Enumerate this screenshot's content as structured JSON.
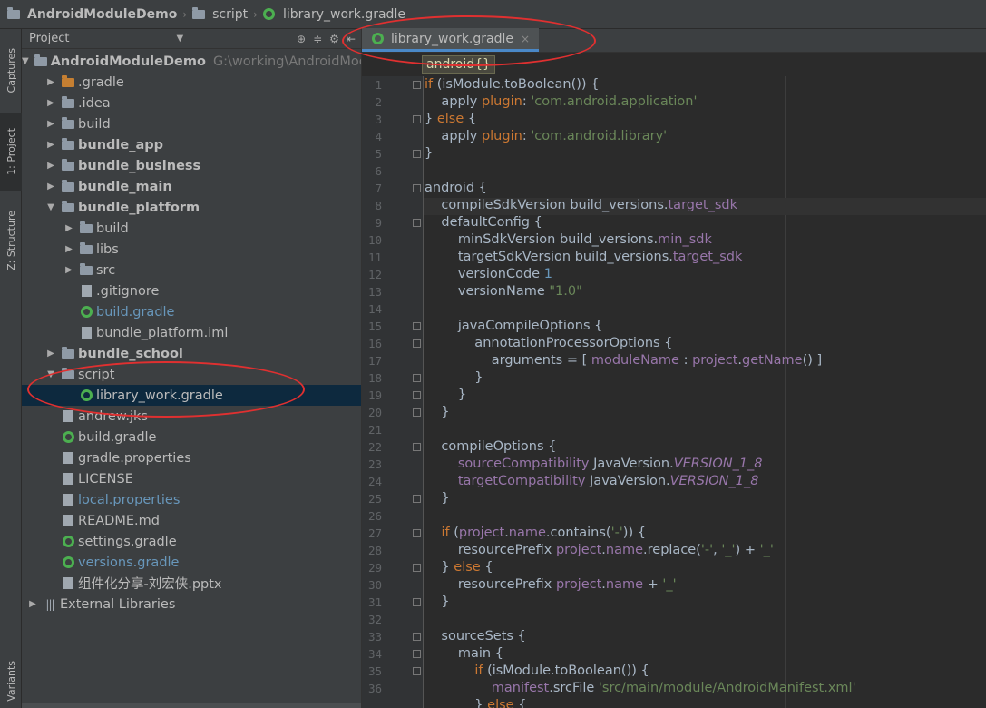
{
  "breadcrumb": {
    "project": "AndroidModuleDemo",
    "folder": "script",
    "file": "library_work.gradle"
  },
  "left_strip": {
    "tabs": [
      "Captures",
      "1: Project",
      "Z: Structure"
    ],
    "bottom_tab": "Variants"
  },
  "project_panel": {
    "header": "Project",
    "root_path": "G:\\working\\AndroidModu",
    "items": [
      {
        "label": "AndroidModuleDemo",
        "icon": "module-folder-icon"
      },
      {
        "label": ".gradle",
        "icon": "folder-icon"
      },
      {
        "label": ".idea",
        "icon": "folder-icon"
      },
      {
        "label": "build",
        "icon": "folder-icon"
      },
      {
        "label": "bundle_app",
        "icon": "module-folder-icon"
      },
      {
        "label": "bundle_business",
        "icon": "module-folder-icon"
      },
      {
        "label": "bundle_main",
        "icon": "module-folder-icon"
      },
      {
        "label": "bundle_platform",
        "icon": "module-folder-icon"
      },
      {
        "label": "build",
        "icon": "folder-icon"
      },
      {
        "label": "libs",
        "icon": "folder-icon"
      },
      {
        "label": "src",
        "icon": "folder-icon"
      },
      {
        "label": ".gitignore",
        "icon": "file-icon"
      },
      {
        "label": "build.gradle",
        "icon": "gradle-icon"
      },
      {
        "label": "bundle_platform.iml",
        "icon": "file-icon"
      },
      {
        "label": "bundle_school",
        "icon": "module-folder-icon"
      },
      {
        "label": "script",
        "icon": "folder-icon"
      },
      {
        "label": "library_work.gradle",
        "icon": "gradle-icon"
      },
      {
        "label": "andrew.jks",
        "icon": "file-icon"
      },
      {
        "label": "build.gradle",
        "icon": "gradle-icon"
      },
      {
        "label": "gradle.properties",
        "icon": "file-icon"
      },
      {
        "label": "LICENSE",
        "icon": "file-icon"
      },
      {
        "label": "local.properties",
        "icon": "file-icon"
      },
      {
        "label": "README.md",
        "icon": "file-icon"
      },
      {
        "label": "settings.gradle",
        "icon": "gradle-icon"
      },
      {
        "label": "versions.gradle",
        "icon": "gradle-icon"
      },
      {
        "label": "组件化分享-刘宏侠.pptx",
        "icon": "file-icon"
      },
      {
        "label": "External Libraries",
        "icon": "library-icon"
      }
    ]
  },
  "editor": {
    "tab": "library_work.gradle",
    "breadcrumb": "android{}",
    "line_numbers": [
      "1",
      "2",
      "3",
      "4",
      "5",
      "6",
      "7",
      "8",
      "9",
      "10",
      "11",
      "12",
      "13",
      "14",
      "15",
      "16",
      "17",
      "18",
      "19",
      "20",
      "21",
      "22",
      "23",
      "24",
      "25",
      "26",
      "27",
      "28",
      "29",
      "30",
      "31",
      "32",
      "33",
      "34",
      "35",
      "36"
    ],
    "code": [
      [
        [
          "k",
          "if "
        ],
        [
          "t",
          "(isModule."
        ],
        [
          "t",
          "toBoolean"
        ],
        [
          "t",
          "()) {"
        ]
      ],
      [
        [
          "t",
          "    apply "
        ],
        [
          "k",
          "plugin"
        ],
        [
          "t",
          ": "
        ],
        [
          "s",
          "'com.android.application'"
        ]
      ],
      [
        [
          "t",
          "} "
        ],
        [
          "k",
          "else"
        ],
        [
          "t",
          " {"
        ]
      ],
      [
        [
          "t",
          "    apply "
        ],
        [
          "k",
          "plugin"
        ],
        [
          "t",
          ": "
        ],
        [
          "s",
          "'com.android.library'"
        ]
      ],
      [
        [
          "t",
          "}"
        ]
      ],
      [
        [
          "t",
          ""
        ]
      ],
      [
        [
          "t",
          "android {"
        ]
      ],
      [
        [
          "t",
          "    compileSdkVersion build_versions."
        ],
        [
          "p",
          "target_sdk"
        ]
      ],
      [
        [
          "t",
          "    defaultConfig {"
        ]
      ],
      [
        [
          "t",
          "        minSdkVersion build_versions."
        ],
        [
          "p",
          "min_sdk"
        ]
      ],
      [
        [
          "t",
          "        targetSdkVersion build_versions."
        ],
        [
          "p",
          "target_sdk"
        ]
      ],
      [
        [
          "t",
          "        versionCode "
        ],
        [
          "n",
          "1"
        ]
      ],
      [
        [
          "t",
          "        versionName "
        ],
        [
          "s",
          "\"1.0\""
        ]
      ],
      [
        [
          "t",
          ""
        ]
      ],
      [
        [
          "t",
          "        javaCompileOptions {"
        ]
      ],
      [
        [
          "t",
          "            annotationProcessorOptions {"
        ]
      ],
      [
        [
          "t",
          "                arguments = [ "
        ],
        [
          "p",
          "moduleName"
        ],
        [
          "t",
          " : "
        ],
        [
          "p",
          "project"
        ],
        [
          "t",
          "."
        ],
        [
          "p",
          "getName"
        ],
        [
          "t",
          "() ]"
        ]
      ],
      [
        [
          "t",
          "            }"
        ]
      ],
      [
        [
          "t",
          "        }"
        ]
      ],
      [
        [
          "t",
          "    }"
        ]
      ],
      [
        [
          "t",
          ""
        ]
      ],
      [
        [
          "t",
          "    compileOptions {"
        ]
      ],
      [
        [
          "t",
          "        "
        ],
        [
          "p",
          "sourceCompatibility"
        ],
        [
          "t",
          " JavaVersion."
        ],
        [
          "pi",
          "VERSION_1_8"
        ]
      ],
      [
        [
          "t",
          "        "
        ],
        [
          "p",
          "targetCompatibility"
        ],
        [
          "t",
          " JavaVersion."
        ],
        [
          "pi",
          "VERSION_1_8"
        ]
      ],
      [
        [
          "t",
          "    }"
        ]
      ],
      [
        [
          "t",
          ""
        ]
      ],
      [
        [
          "t",
          "    "
        ],
        [
          "k",
          "if "
        ],
        [
          "t",
          "("
        ],
        [
          "p",
          "project"
        ],
        [
          "t",
          "."
        ],
        [
          "p",
          "name"
        ],
        [
          "t",
          ".contains("
        ],
        [
          "s",
          "'-'"
        ],
        [
          "t",
          ")) {"
        ]
      ],
      [
        [
          "t",
          "        resourcePrefix "
        ],
        [
          "p",
          "project"
        ],
        [
          "t",
          "."
        ],
        [
          "p",
          "name"
        ],
        [
          "t",
          ".replace("
        ],
        [
          "s",
          "'-'"
        ],
        [
          "t",
          ", "
        ],
        [
          "s",
          "'_'"
        ],
        [
          "t",
          ") + "
        ],
        [
          "s",
          "'_'"
        ]
      ],
      [
        [
          "t",
          "    } "
        ],
        [
          "k",
          "else"
        ],
        [
          "t",
          " {"
        ]
      ],
      [
        [
          "t",
          "        resourcePrefix "
        ],
        [
          "p",
          "project"
        ],
        [
          "t",
          "."
        ],
        [
          "p",
          "name"
        ],
        [
          "t",
          " + "
        ],
        [
          "s",
          "'_'"
        ]
      ],
      [
        [
          "t",
          "    }"
        ]
      ],
      [
        [
          "t",
          ""
        ]
      ],
      [
        [
          "t",
          "    sourceSets {"
        ]
      ],
      [
        [
          "t",
          "        main {"
        ]
      ],
      [
        [
          "t",
          "            "
        ],
        [
          "k",
          "if "
        ],
        [
          "t",
          "(isModule."
        ],
        [
          "t",
          "toBoolean"
        ],
        [
          "t",
          "()) {"
        ]
      ],
      [
        [
          "t",
          "                "
        ],
        [
          "p",
          "manifest"
        ],
        [
          "t",
          ".srcFile "
        ],
        [
          "s",
          "'src/main/module/AndroidManifest.xml'"
        ]
      ],
      [
        [
          "t",
          "            } "
        ],
        [
          "k",
          "else"
        ],
        [
          "t",
          " {"
        ]
      ]
    ]
  }
}
